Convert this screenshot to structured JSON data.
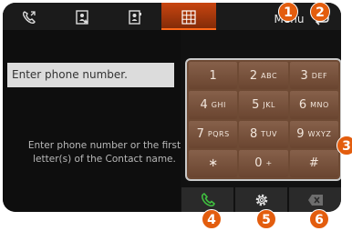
{
  "tabs": [
    {
      "icon": "call-history-icon"
    },
    {
      "icon": "favorites-contacts-icon"
    },
    {
      "icon": "contacts-icon"
    },
    {
      "icon": "dial-pad-icon",
      "active": true
    }
  ],
  "header": {
    "menu_label": "Menu",
    "back_icon": "back-arrow-icon"
  },
  "input": {
    "placeholder": "Enter phone number."
  },
  "helper_text": "Enter phone number or the first letter(s) of the Contact name.",
  "keypad": [
    {
      "digit": "1",
      "letters": ""
    },
    {
      "digit": "2",
      "letters": "ABC"
    },
    {
      "digit": "3",
      "letters": "DEF"
    },
    {
      "digit": "4",
      "letters": "GHI"
    },
    {
      "digit": "5",
      "letters": "JKL"
    },
    {
      "digit": "6",
      "letters": "MNO"
    },
    {
      "digit": "7",
      "letters": "PQRS"
    },
    {
      "digit": "8",
      "letters": "TUV"
    },
    {
      "digit": "9",
      "letters": "WXYZ"
    },
    {
      "digit": "∗",
      "letters": ""
    },
    {
      "digit": "0",
      "letters": "+"
    },
    {
      "digit": "#",
      "letters": ""
    }
  ],
  "bottom_buttons": [
    {
      "icon": "call-icon"
    },
    {
      "icon": "settings-icon"
    },
    {
      "icon": "backspace-icon"
    }
  ],
  "badges": [
    "1",
    "2",
    "3",
    "4",
    "5",
    "6"
  ],
  "colors": {
    "accent": "#e35d0e",
    "keypad": "#6e4a34",
    "call_green": "#3fbf3f"
  }
}
